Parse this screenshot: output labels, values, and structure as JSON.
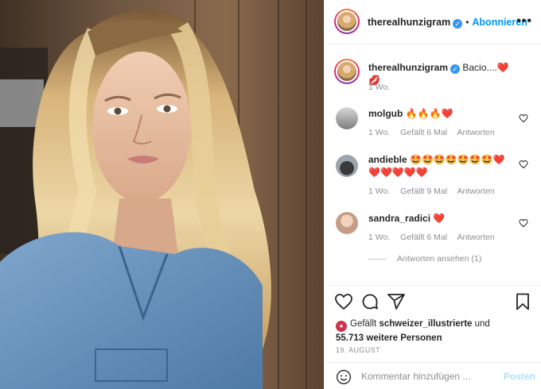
{
  "header": {
    "username": "therealhunzigram",
    "separator": "•",
    "follow_label": "Abonnieren",
    "more_icon": "more-dots-icon"
  },
  "caption": {
    "username": "therealhunzigram",
    "text": "Bacio....❤️💋",
    "time": "1 Wo."
  },
  "comments": [
    {
      "username": "molgub",
      "text": "🔥🔥🔥❤️",
      "time": "1 Wo.",
      "likes": "Gefällt 6 Mal",
      "reply": "Antworten"
    },
    {
      "username": "andieble",
      "text": "🤩🤩🤩🤩🤩🤩🤩❤️",
      "text2": "❤️❤️❤️❤️❤️",
      "time": "1 Wo.",
      "likes": "Gefällt 9 Mal",
      "reply": "Antworten"
    },
    {
      "username": "sandra_radici",
      "text": "❤️",
      "time": "1 Wo.",
      "likes": "Gefällt 6 Mal",
      "reply": "Antworten"
    }
  ],
  "view_replies": "Antworten ansehen (1)",
  "actions": {
    "icons": [
      "heart-icon",
      "comment-icon",
      "share-icon",
      "bookmark-icon"
    ],
    "likes_prefix": "Gefällt",
    "likes_user": "schweizer_illustrierte",
    "likes_and": "und",
    "likes_count": "55.713 weitere Personen",
    "date": "19. AUGUST"
  },
  "comment_box": {
    "placeholder": "Kommentar hinzufügen ...",
    "post_label": "Posten"
  },
  "colors": {
    "accent": "#0095f6",
    "verified": "#3897f0",
    "muted": "#8e8e8e",
    "heart_emoji": "#e0241f"
  }
}
